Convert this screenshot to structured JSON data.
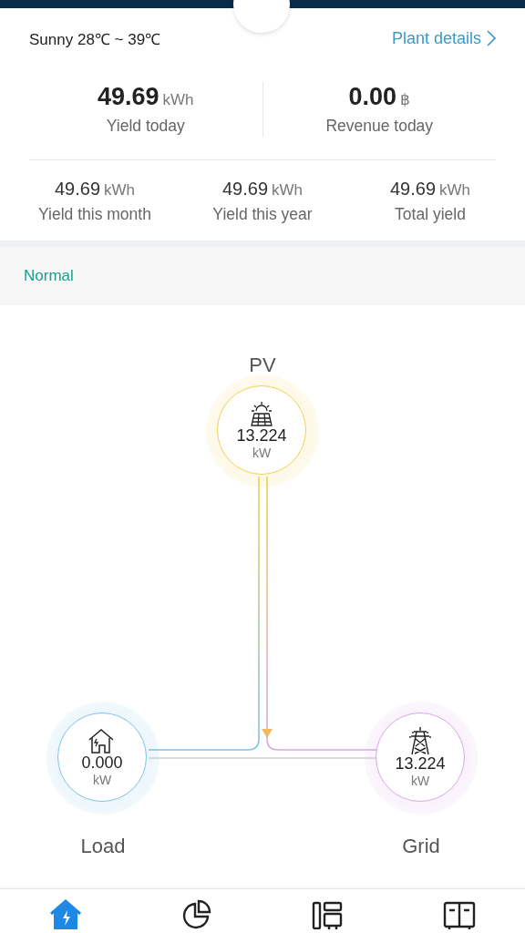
{
  "weather": "Sunny 28℃ ~ 39℃",
  "plant_link": "Plant details",
  "today": [
    {
      "value": "49.69",
      "unit": "kWh",
      "label": "Yield today"
    },
    {
      "value": "0.00",
      "unit": "฿",
      "label": "Revenue today"
    }
  ],
  "totals": [
    {
      "value": "49.69",
      "unit": "kWh",
      "label": "Yield this month"
    },
    {
      "value": "49.69",
      "unit": "kWh",
      "label": "Yield this year"
    },
    {
      "value": "49.69",
      "unit": "kWh",
      "label": "Total yield"
    }
  ],
  "status": {
    "text": "Normal"
  },
  "flow": {
    "nodes": [
      {
        "kind": "pv",
        "label": "PV",
        "value": "13.224",
        "unit": "kW",
        "color": "#f2cf52"
      },
      {
        "kind": "load",
        "label": "Load",
        "value": "0.000",
        "unit": "kW",
        "color": "#7cc3e6"
      },
      {
        "kind": "grid",
        "label": "Grid",
        "value": "13.224",
        "unit": "kW",
        "color": "#d9a6e6"
      }
    ]
  },
  "nav": [
    {
      "kind": "home",
      "selected": true
    },
    {
      "kind": "stats",
      "selected": false
    },
    {
      "kind": "devices",
      "selected": false
    },
    {
      "kind": "inverter",
      "selected": false
    }
  ]
}
